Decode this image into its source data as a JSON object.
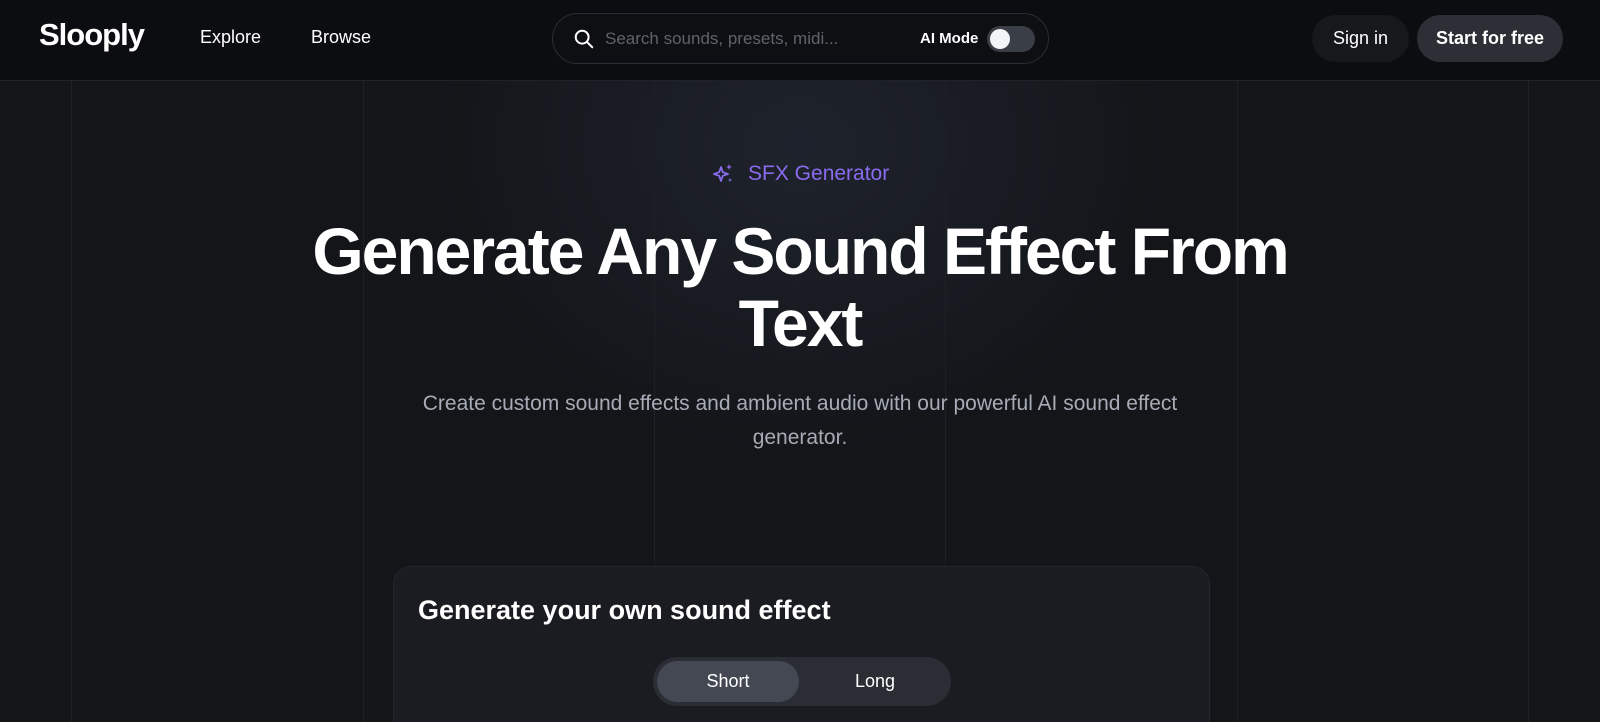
{
  "header": {
    "logo": "Slooply",
    "nav": {
      "explore": "Explore",
      "browse": "Browse"
    },
    "search": {
      "placeholder": "Search sounds, presets, midi...",
      "value": "",
      "ai_mode_label": "AI Mode",
      "ai_mode_on": false
    },
    "sign_in": "Sign in",
    "start_free": "Start for free"
  },
  "hero": {
    "badge": "SFX Generator",
    "title": "Generate Any Sound Effect From Text",
    "subtitle": "Create custom sound effects and ambient audio with our powerful AI sound effect generator."
  },
  "card": {
    "title": "Generate your own sound effect",
    "tabs": [
      {
        "label": "Short",
        "selected": true
      },
      {
        "label": "Long",
        "selected": false
      }
    ]
  },
  "colors": {
    "accent": "#8b6cf0",
    "background": "#131519",
    "header": "#0c0d10",
    "card": "#1a1c21"
  },
  "icons": {
    "search": "search-icon",
    "sparkle": "sparkle-icon"
  }
}
